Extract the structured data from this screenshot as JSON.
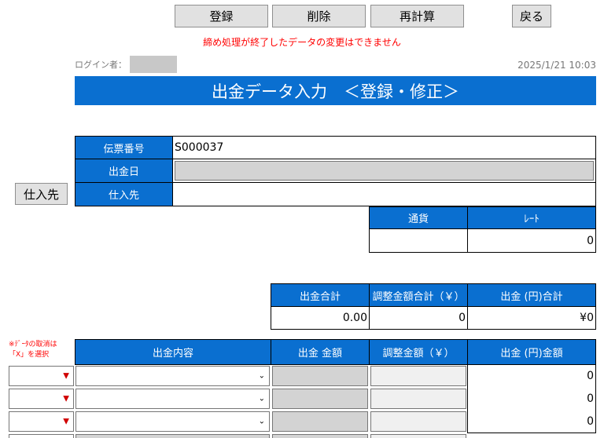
{
  "toolbar": {
    "register_label": "登録",
    "delete_label": "削除",
    "recalc_label": "再計算",
    "back_label": "戻る"
  },
  "warning": "締め処理が終了したデータの変更はできません",
  "login_label": "ログイン者：",
  "datetime": "2025/1/21 10:03",
  "page_title": "出金データ入力　＜登録・修正＞",
  "form": {
    "slip_no_label": "伝票番号",
    "slip_no_value": "S000037",
    "date_label": "出金日",
    "supplier_label": "仕入先",
    "supplier_button": "仕入先"
  },
  "currency": {
    "currency_label": "通貨",
    "rate_label": "ﾚｰﾄ",
    "rate_value": "0"
  },
  "totals": {
    "payment_total_label": "出金合計",
    "adjust_total_label": "調整金額合計（￥）",
    "yen_total_label": "出金 (円)合計",
    "payment_total_value": "0.00",
    "adjust_total_value": "0",
    "yen_total_value": "¥0"
  },
  "detail": {
    "note": "※ﾃﾞｰﾀの取消は「X」を選択",
    "col_content": "出金内容",
    "col_amount": "出金 金額",
    "col_adjust": "調整金額（￥）",
    "col_yen": "出金 (円)金額",
    "rows": [
      {
        "yen": "0"
      },
      {
        "yen": "0"
      },
      {
        "yen": "0"
      }
    ]
  }
}
